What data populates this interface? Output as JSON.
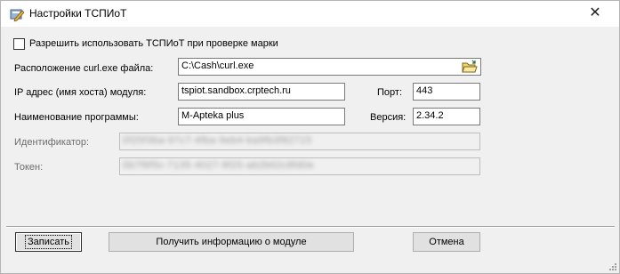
{
  "window": {
    "title": "Настройки ТСПИоТ",
    "close_glyph": "✕",
    "app_icon": "pencil-app-icon"
  },
  "form": {
    "allow_checkbox_label": "Разрешить использовать ТСПИоТ при проверке марки",
    "allow_checked": false,
    "curl_label": "Расположение curl.exe файла:",
    "curl_value": "C:\\Cash\\curl.exe",
    "browse_icon": "open-folder-icon",
    "ip_label": "IP адрес (имя хоста) модуля:",
    "ip_value": "tspiot.sandbox.crptech.ru",
    "port_label": "Порт:",
    "port_value": "443",
    "program_label": "Наименование программы:",
    "program_value": "M-Apteka plus",
    "version_label": "Версия:",
    "version_value": "2.34.2",
    "identifier_label": "Идентификатор:",
    "identifier_value": "0f25f3ba-97c7-4fba-9eb4-ba9fb3f82715",
    "token_label": "Токен:",
    "token_value": "0b7f9f5c-7135-4027-9f25-ab2b62c8fd0e"
  },
  "buttons": {
    "save": "Записать",
    "get_info": "Получить информацию о модуле",
    "cancel": "Отмена"
  }
}
